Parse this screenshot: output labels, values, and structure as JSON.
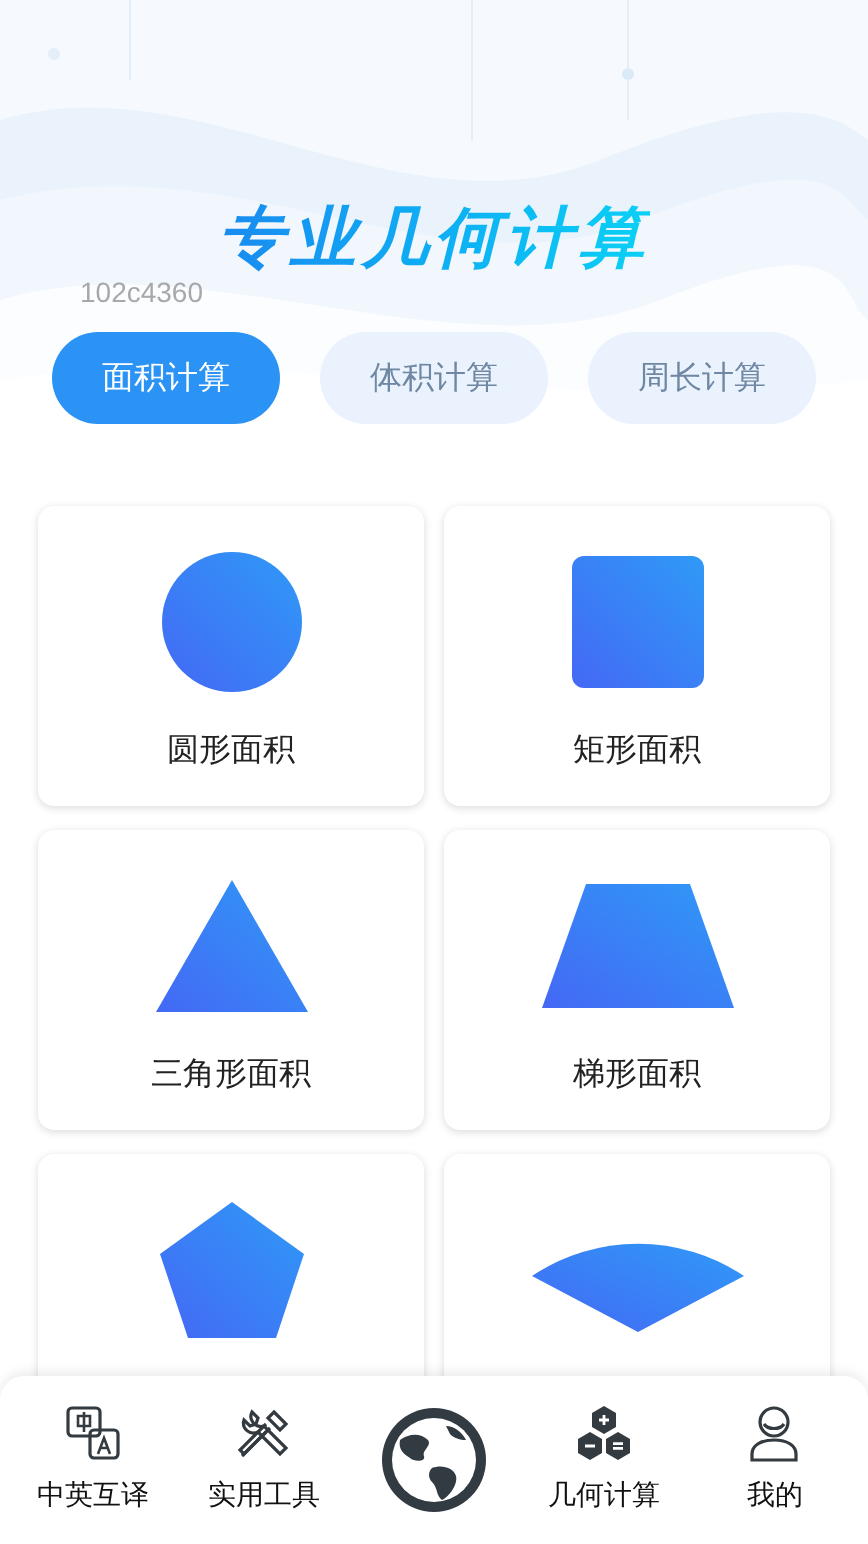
{
  "header": {
    "title": "专业几何计算",
    "code": "102c4360"
  },
  "tabs": [
    {
      "label": "面积计算",
      "selected": true
    },
    {
      "label": "体积计算",
      "selected": false
    },
    {
      "label": "周长计算",
      "selected": false
    }
  ],
  "cards": [
    {
      "kind": "circle",
      "label": "圆形面积"
    },
    {
      "kind": "square",
      "label": "矩形面积"
    },
    {
      "kind": "triangle",
      "label": "三角形面积"
    },
    {
      "kind": "trapezoid",
      "label": "梯形面积"
    },
    {
      "kind": "pentagon"
    },
    {
      "kind": "sector"
    }
  ],
  "nav": [
    {
      "kind": "translate",
      "label": "中英互译"
    },
    {
      "kind": "tools",
      "label": "实用工具"
    },
    {
      "kind": "globe"
    },
    {
      "kind": "hexagons",
      "label": "几何计算"
    },
    {
      "kind": "profile",
      "label": "我的"
    }
  ]
}
